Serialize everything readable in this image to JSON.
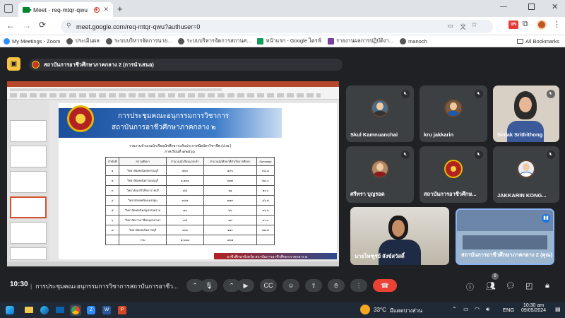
{
  "browser": {
    "tab_title": "Meet - req-mtqr-qwu",
    "new_tab": "+",
    "url": "meet.google.com/req-mtqr-qwu?authuser=0",
    "bookmarks": [
      {
        "label": "My Meetings - Zoom",
        "color": "#2d8cff"
      },
      {
        "label": "ประเมินผล",
        "color": "#555555"
      },
      {
        "label": "ระบบบริหารจัดการนาย...",
        "color": "#555555"
      },
      {
        "label": "ระบบบริหารจัดการสถานศ...",
        "color": "#555555"
      },
      {
        "label": "หน้าแรก - Google ไดรฟ์",
        "color": "#0f9d58"
      },
      {
        "label": "รายงานผลการปฏิบัติงา...",
        "color": "#7b3fa0"
      },
      {
        "label": "manoch",
        "color": "#555555"
      }
    ],
    "all_bookmarks": "All Bookmarks"
  },
  "meet": {
    "presenter_banner": "สถาบันการอาชีวศึกษาภาคกลาง 2 (การนำเสนอ)",
    "slide": {
      "title_line1": "การประชุมคณะอนุกรรมการวิชาการ",
      "title_line2": "สถาบันการอาชีวศึกษาภาคกลาง ๒",
      "table_heading": "รายงานจำนวนนักเรียนนักศึกษาระดับประกาศนียบัตรวิชาชีพ (ปวช.)",
      "table_subheading": "ภาคเรียนที่ ๑/๒๕๖๖",
      "columns": [
        "ลำดับที่",
        "สถานศึกษา",
        "จำนวนนักเรียนแรกเข้า",
        "จำนวนนักศึกษาที่สำเร็จการศึกษา",
        "Summary"
      ],
      "rows": [
        [
          "๑",
          "วิทยาลัยเทคนิคสุพรรณบุรี",
          "๕๖๓",
          "๑๙๖",
          "๓๔.๘"
        ],
        [
          "๒",
          "วิทยาลัยเทคนิคกาญจนบุรี",
          "๑,๑๓๑",
          "๓๑๗",
          "๒๘.๐"
        ],
        [
          "๓",
          "วิทยาลัยอาชีวศึกษาราชบุรี",
          "๕๕",
          "๑๑",
          "๒๐.๐"
        ],
        [
          "๔",
          "วิทยาลัยเทคนิคนครปฐม",
          "๓๘๗",
          "๑๗๙",
          "๔๖.๒"
        ],
        [
          "๕",
          "วิทยาลัยเทคนิคสมุทรสงคราม",
          "๗๑",
          "๒๖",
          "๓๖.๖"
        ],
        [
          "๖",
          "วิทยาลัยการอาชีพสมุทรสาคร",
          "๔๕",
          "๑๘",
          "๔๐.๐"
        ],
        [
          "๗",
          "วิทยาลัยเทคนิคราชบุรี",
          "๔๓๖",
          "๑๒๐",
          "๒๗.๕"
        ],
        [
          "",
          "รวม",
          "๒,๖๘๘",
          "๘๖๗",
          ""
        ]
      ],
      "footer": "อาชีวศึกษาจังหวัด สถาบันการอาชีวศึกษาภาคกลาง ๒"
    },
    "participants": [
      {
        "name": "Skul Kamnuanchai"
      },
      {
        "name": "kru jakkarin"
      },
      {
        "name": "Sinlak Srithithong"
      },
      {
        "name": "ศรีทรา บุญรอด"
      },
      {
        "name": "สถาบันการอาชีวศึกษ..."
      },
      {
        "name": "JAKKARIN KONG..."
      },
      {
        "name": "นายไพฑูรย์ สังข์สวัสดิ์"
      },
      {
        "name": "สถาบันการอาชีวศึกษาภาคกลาง 2 (คุณ)"
      }
    ],
    "meeting_time": "10:30",
    "meeting_title": "การประชุมคณะอนุกรรมการวิชาการสถาบันการอาชีว...",
    "people_count": "9"
  },
  "taskbar": {
    "weather": "33°C",
    "weather_desc": "มีแดดบางส่วน",
    "lang": "ENG",
    "time": "10:30 am",
    "date": "09/05/2024"
  },
  "colors": {
    "meet_bg": "#202124",
    "tile": "#3c4043",
    "end_call": "#ea4335",
    "active_border": "#8ab4f8"
  }
}
